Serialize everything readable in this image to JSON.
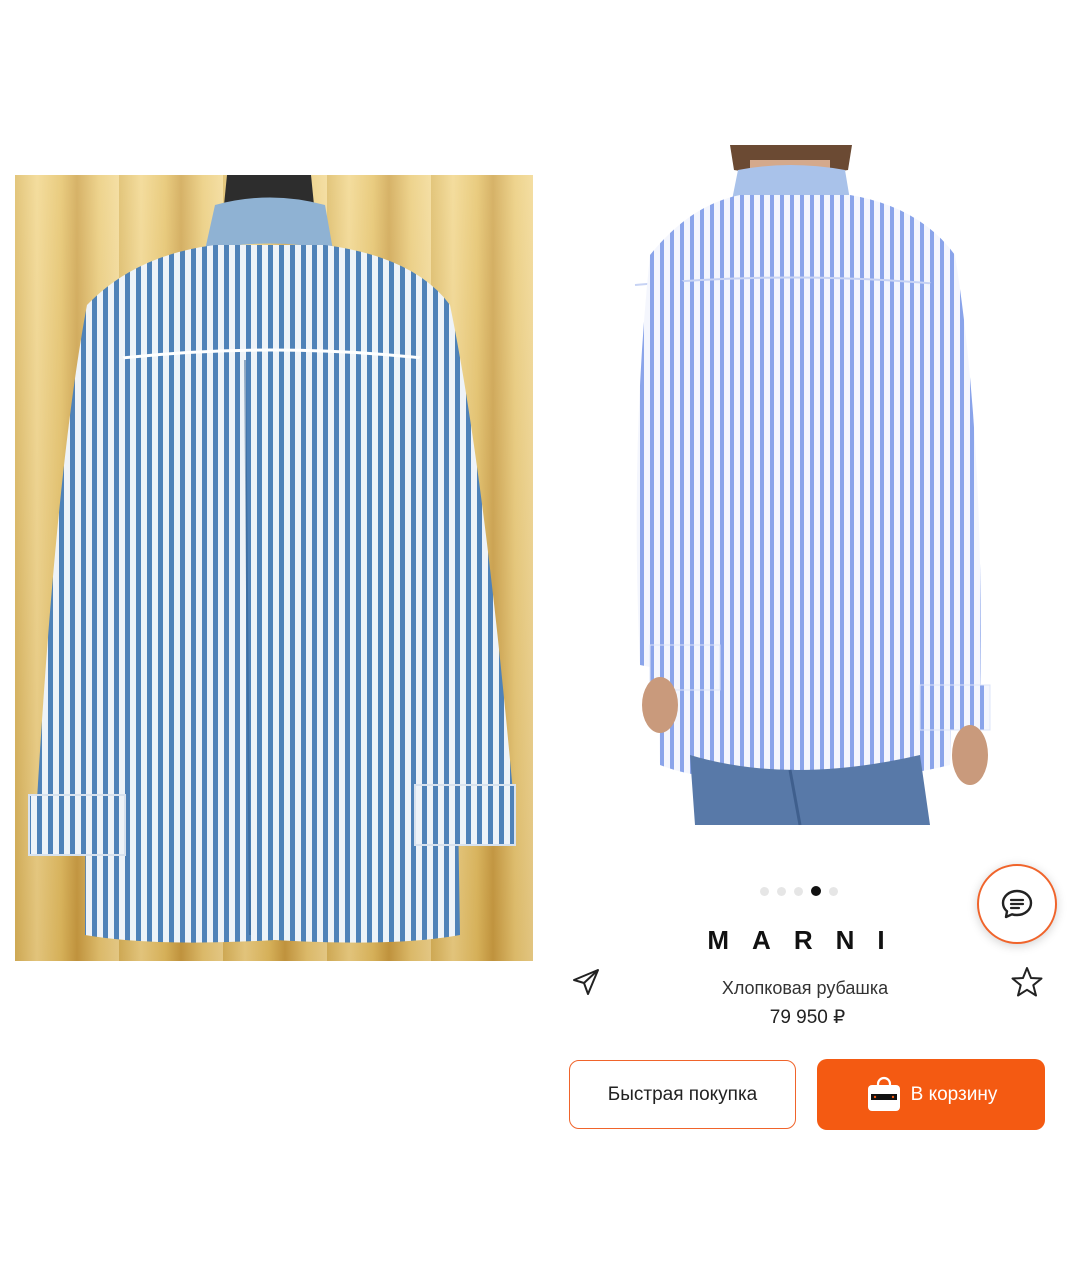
{
  "product": {
    "brand": "MARNI",
    "title": "Хлопковая рубашка",
    "price": "79 950 ₽"
  },
  "gallery": {
    "total_slides": 5,
    "active_index": 3
  },
  "actions": {
    "quick_buy_label": "Быстрая покупка",
    "add_to_cart_label": "В корзину"
  },
  "icons": {
    "share": "paper-plane-icon",
    "favorite": "star-outline-icon",
    "chat": "chat-bubble-icon",
    "cart": "shopping-bag-icon"
  },
  "colors": {
    "accent": "#f45a12",
    "accent_border": "#f0642b"
  }
}
